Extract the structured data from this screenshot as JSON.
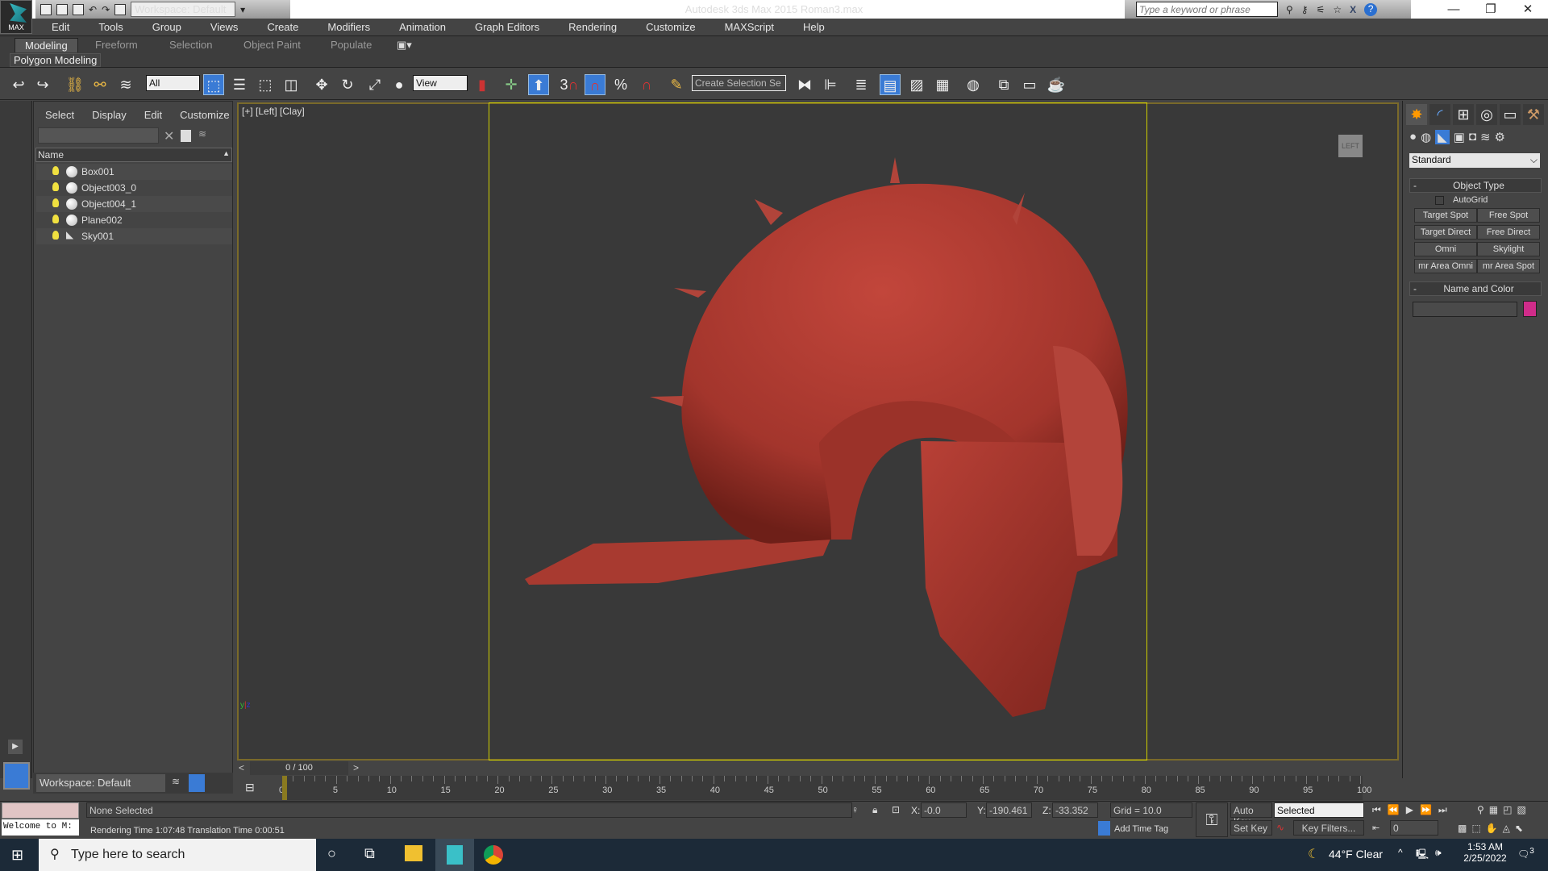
{
  "title_bar": {
    "workspace": "Workspace: Default",
    "app_title": "Autodesk 3ds Max  2015     Roman3.max",
    "help_search_placeholder": "Type a keyword or phrase",
    "logo_text": "MAX"
  },
  "menu": [
    "Edit",
    "Tools",
    "Group",
    "Views",
    "Create",
    "Modifiers",
    "Animation",
    "Graph Editors",
    "Rendering",
    "Customize",
    "MAXScript",
    "Help"
  ],
  "ribbon": {
    "tabs": [
      "Modeling",
      "Freeform",
      "Selection",
      "Object Paint",
      "Populate"
    ],
    "active": "Modeling",
    "panel": "Polygon Modeling"
  },
  "toolbar": {
    "selection_filter": "All",
    "ref_coord": "View",
    "named_selection": "Create Selection Se",
    "snap_label": "3"
  },
  "scene_explorer": {
    "menu": [
      "Select",
      "Display",
      "Edit",
      "Customize"
    ],
    "column": "Name",
    "objects": [
      "Box001",
      "Object003_0",
      "Object004_1",
      "Plane002",
      "Sky001"
    ],
    "workspace": "Workspace: Default"
  },
  "viewport": {
    "label": "[+] [Left] [Clay]",
    "viewcube": "LEFT"
  },
  "command_panel": {
    "category": "Standard",
    "object_type_title": "Object Type",
    "autogrid": "AutoGrid",
    "buttons": [
      "Target Spot",
      "Free Spot",
      "Target Direct",
      "Free Direct",
      "Omni",
      "Skylight",
      "mr Area Omni",
      "mr Area Spot"
    ],
    "name_color_title": "Name and Color",
    "object_color": "#d02c8a"
  },
  "timeline": {
    "frame": "0 / 100",
    "ticks": [
      0,
      5,
      10,
      15,
      20,
      25,
      30,
      35,
      40,
      45,
      50,
      55,
      60,
      65,
      70,
      75,
      80,
      85,
      90,
      95,
      100
    ]
  },
  "status": {
    "listener": "Welcome to M:",
    "selection": "None Selected",
    "render_info": "Rendering Time  1:07:48     Translation Time  0:00:51",
    "x_label": "X:",
    "x": "-0.0",
    "y_label": "Y:",
    "y": "-190.461",
    "z_label": "Z:",
    "z": "-33.352",
    "grid": "Grid = 10.0",
    "add_time_tag": "Add Time Tag",
    "auto_key": "Auto Key",
    "set_key": "Set Key",
    "key_mode": "Selected",
    "key_filters": "Key Filters...",
    "current_frame": "0"
  },
  "taskbar": {
    "search_placeholder": "Type here to search",
    "weather": "44°F  Clear",
    "time": "1:53 AM",
    "date": "2/25/2022",
    "notifications": "3"
  }
}
